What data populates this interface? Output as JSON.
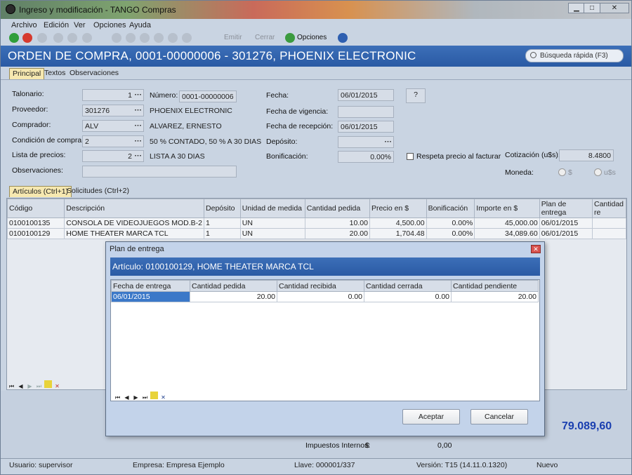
{
  "window": {
    "title": "Ingreso y modificación - TANGO Compras",
    "min_label": "▁",
    "max_label": "□",
    "close_label": "✕"
  },
  "menu": [
    "Archivo",
    "Edición",
    "Ver",
    "Opciones",
    "Ayuda"
  ],
  "toolbar": {
    "emitir": "Emitir",
    "cerrar": "Cerrar",
    "opciones": "Opciones"
  },
  "header": {
    "doc_title": "ORDEN DE COMPRA,   0001-00000006 - 301276, PHOENIX ELECTRONIC",
    "search": "Búsqueda rápida (F3)"
  },
  "tabs": [
    "Principal",
    "Textos",
    "Observaciones"
  ],
  "form": {
    "talonario_label": "Talonario:",
    "talonario": "1",
    "numero_label": "Número:",
    "numero": "0001-00000006",
    "proveedor_label": "Proveedor:",
    "proveedor": "301276",
    "proveedor_name": "PHOENIX ELECTRONIC",
    "comprador_label": "Comprador:",
    "comprador": "ALV",
    "comprador_name": "ALVAREZ, ERNESTO",
    "condicion_label": "Condición de compra:",
    "condicion": "2",
    "condicion_desc": "50 % CONTADO, 50 % A 30 DIAS",
    "lista_label": "Lista de precios:",
    "lista": "2",
    "lista_desc": "LISTA A 30 DIAS",
    "obs_label": "Observaciones:",
    "fecha_label": "Fecha:",
    "fecha": "06/01/2015",
    "vigencia_label": "Fecha de vigencia:",
    "recepcion_label": "Fecha de recepción:",
    "recepcion": "06/01/2015",
    "deposito_label": "Depósito:",
    "bonificacion_label": "Bonificación:",
    "bonificacion": "0.00%",
    "respeta_label": "Respeta precio al facturar",
    "cotizacion_label": "Cotización (u$s):",
    "cotizacion": "8.4800",
    "moneda_label": "Moneda:",
    "moneda_pesos": "$",
    "moneda_usd": "u$s"
  },
  "tabs2": [
    "Artículos (Ctrl+1)",
    "Solicitudes (Ctrl+2)"
  ],
  "grid": {
    "columns": [
      "Código",
      "Descripción",
      "Depósito",
      "Unidad de medida",
      "Cantidad pedida",
      "Precio en $",
      "Bonificación",
      "Importe en $",
      "Plan de entrega",
      "Cantidad re"
    ],
    "rows": [
      [
        "0100100135",
        "CONSOLA DE VIDEOJUEGOS MOD.B-2",
        "1",
        "UN",
        "10.00",
        "4,500.00",
        "0.00%",
        "45,000.00",
        "06/01/2015",
        ""
      ],
      [
        "0100100129",
        "HOME THEATER MARCA TCL",
        "1",
        "UN",
        "20.00",
        "1,704.48",
        "0.00%",
        "34,089.60",
        "06/01/2015",
        ""
      ]
    ]
  },
  "totals": {
    "total": "79.089,60",
    "impuestos_label": "Impuestos Internos:",
    "impuestos_cur": "$",
    "impuestos": "0,00"
  },
  "status": {
    "usuario": "Usuario: supervisor",
    "empresa": "Empresa: Empresa Ejemplo",
    "llave": "Llave: 000001/337",
    "version": "Versión: T15 (14.11.0.1320)",
    "estado": "Nuevo"
  },
  "dialog": {
    "title": "Plan de entrega",
    "header": "Artículo: 0100100129, HOME THEATER MARCA TCL",
    "columns": [
      "Fecha de entrega",
      "Cantidad pedida",
      "Cantidad recibida",
      "Cantidad cerrada",
      "Cantidad pendiente"
    ],
    "rows": [
      [
        "06/01/2015",
        "20.00",
        "0.00",
        "0.00",
        "20.00"
      ]
    ],
    "accept": "Aceptar",
    "cancel": "Cancelar"
  }
}
